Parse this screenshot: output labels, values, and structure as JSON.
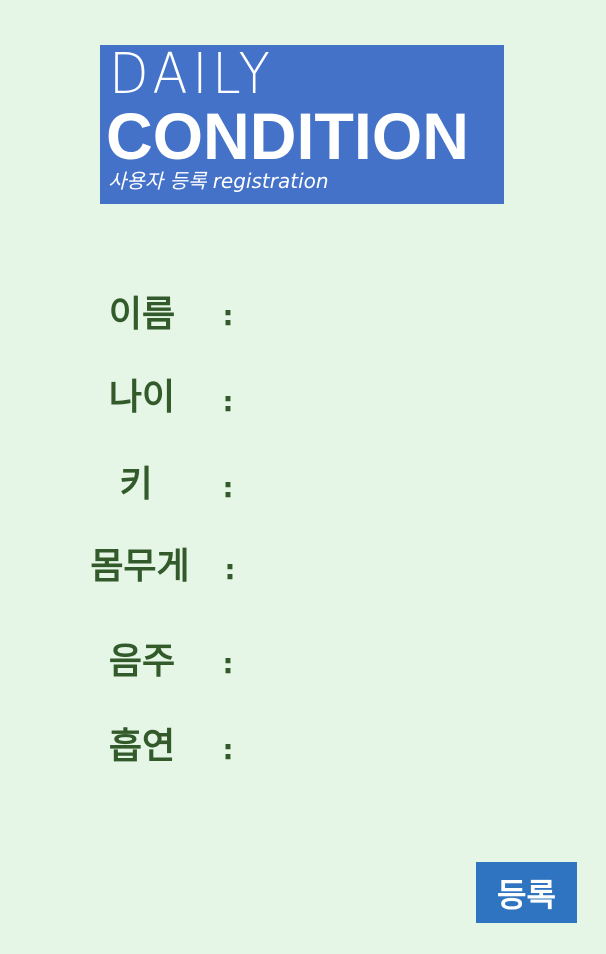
{
  "logo": {
    "line1": "DAILY",
    "line2": "CONDITION",
    "subtitle": "사용자 등록 registration"
  },
  "form": {
    "colon": ":",
    "fields": [
      {
        "label": "이름",
        "value": ""
      },
      {
        "label": "나이",
        "value": ""
      },
      {
        "label": "키",
        "value": ""
      },
      {
        "label": "몸무게",
        "value": ""
      },
      {
        "label": "음주",
        "value": ""
      },
      {
        "label": "흡연",
        "value": ""
      }
    ]
  },
  "submit": {
    "label": "등록",
    "color": "#2f74c0"
  },
  "colors": {
    "background": "#e5f5e6",
    "logo_background": "#4472c8",
    "label_text": "#335a2a"
  }
}
